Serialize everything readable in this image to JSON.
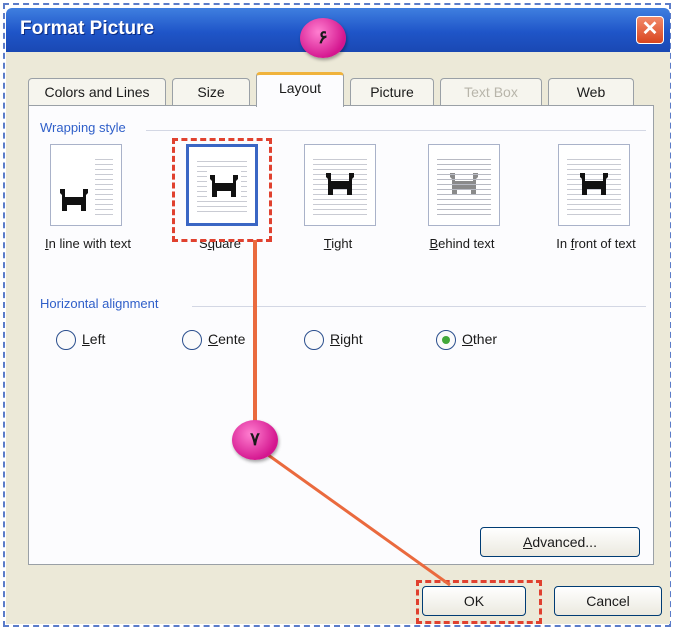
{
  "dialog": {
    "title": "Format Picture",
    "close_icon": "close-icon"
  },
  "tabs": [
    {
      "label": "Colors and Lines",
      "state": "normal"
    },
    {
      "label": "Size",
      "state": "normal"
    },
    {
      "label": "Layout",
      "state": "active"
    },
    {
      "label": "Picture",
      "state": "normal"
    },
    {
      "label": "Text Box",
      "state": "disabled"
    },
    {
      "label": "Web",
      "state": "normal"
    }
  ],
  "wrapping": {
    "group_label": "Wrapping style",
    "selected": "Square",
    "options": [
      {
        "label": "In line with text",
        "mnemonic": "I",
        "rest": "n line with text",
        "icon": "inline-wrap-icon"
      },
      {
        "label": "Square",
        "pre": "S",
        "mnemonic": "q",
        "rest": "uare",
        "icon": "square-wrap-icon"
      },
      {
        "label": "Tight",
        "mnemonic": "T",
        "rest": "ight",
        "icon": "tight-wrap-icon"
      },
      {
        "label": "Behind text",
        "mnemonic": "B",
        "rest": "ehind text",
        "icon": "behind-text-icon"
      },
      {
        "label": "In front of text",
        "pre": "In ",
        "mnemonic": "f",
        "rest": "ront of text",
        "icon": "in-front-icon"
      }
    ]
  },
  "horizontal_alignment": {
    "group_label": "Horizontal alignment",
    "selected": "Other",
    "options": [
      {
        "mnemonic": "L",
        "rest": "eft"
      },
      {
        "mnemonic": "C",
        "rest": "ente"
      },
      {
        "mnemonic": "R",
        "rest": "ight"
      },
      {
        "mnemonic": "O",
        "rest": "ther"
      }
    ]
  },
  "buttons": {
    "advanced": {
      "mnemonic": "A",
      "rest": "dvanced..."
    },
    "ok": "OK",
    "cancel": "Cancel"
  },
  "annotations": {
    "step_6": "۶",
    "step_7": "۷",
    "highlight_color": "#e0412f",
    "pointer_color": "#ea6a3e"
  },
  "colors": {
    "titlebar": "#1f55c8",
    "dialog_bg": "#ece9d8",
    "group_label": "#2f5fc9",
    "active_tab_accent": "#f0b33c"
  }
}
